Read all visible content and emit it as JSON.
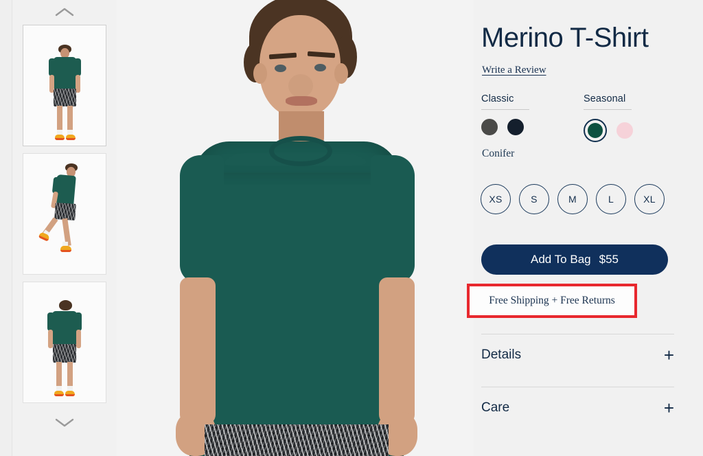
{
  "product": {
    "title": "Merino T-Shirt",
    "review_link": "Write a Review",
    "selected_color_name": "Conifer"
  },
  "color_groups": [
    {
      "label": "Classic",
      "swatches": [
        {
          "name": "charcoal-swatch",
          "hex": "#4a4a48",
          "selected": false
        },
        {
          "name": "navy-swatch",
          "hex": "#141f2d",
          "selected": false
        }
      ]
    },
    {
      "label": "Seasonal",
      "swatches": [
        {
          "name": "conifer-swatch",
          "hex": "#0d5140",
          "selected": true
        },
        {
          "name": "pink-swatch",
          "hex": "#f6d2d9",
          "selected": false
        }
      ]
    }
  ],
  "sizes": [
    {
      "label": "XS",
      "selected": false
    },
    {
      "label": "S",
      "selected": false
    },
    {
      "label": "M",
      "selected": false
    },
    {
      "label": "L",
      "selected": false
    },
    {
      "label": "XL",
      "selected": false
    }
  ],
  "cart": {
    "button_label": "Add To Bag",
    "price": "$55"
  },
  "shipping": {
    "text": "Free Shipping + Free Returns",
    "highlight_color": "#e8282e"
  },
  "accordions": [
    {
      "label": "Details",
      "icon": "plus-icon",
      "expanded": false
    },
    {
      "label": "Care",
      "icon": "plus-icon",
      "expanded": false
    }
  ],
  "gallery": {
    "scroll_up_icon": "chevron-up-icon",
    "scroll_down_icon": "chevron-down-icon",
    "thumbnails": [
      {
        "view": "front",
        "selected": true
      },
      {
        "view": "side-walking",
        "selected": false
      },
      {
        "view": "back",
        "selected": false
      }
    ],
    "hero": {
      "view": "front-closeup"
    }
  },
  "theme": {
    "background": "#f1f1f1",
    "navy": "#122a45",
    "shirt_green": "#1a5b52",
    "button_navy": "#10305c"
  }
}
